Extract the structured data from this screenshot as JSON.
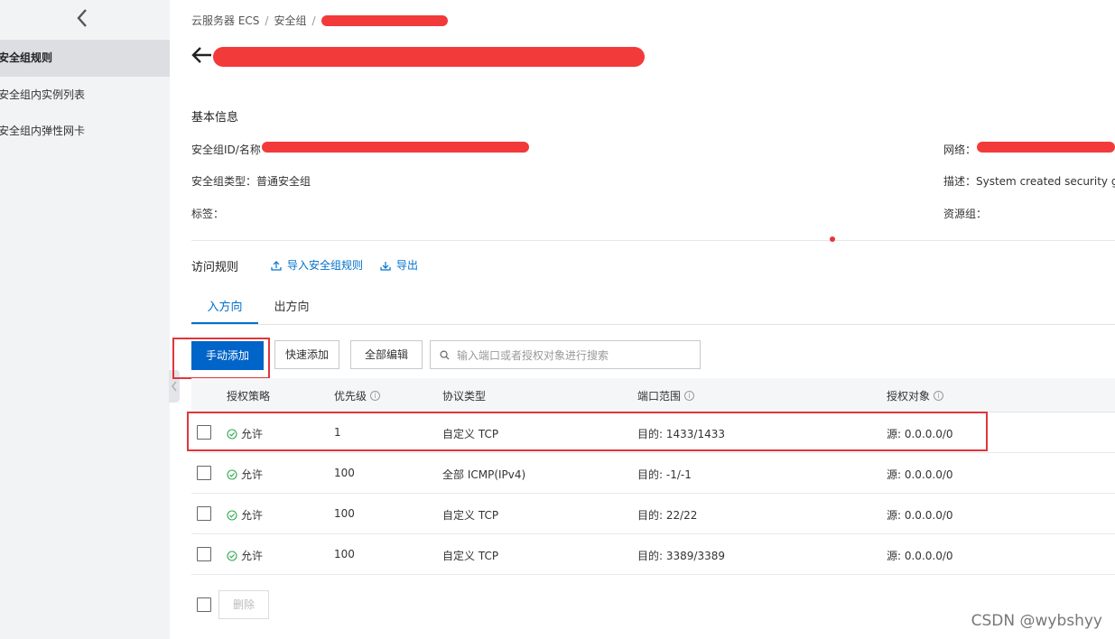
{
  "sidebar": {
    "items": [
      {
        "label": "安全组规则",
        "active": true
      },
      {
        "label": "安全组内实例列表",
        "active": false
      },
      {
        "label": "安全组内弹性网卡",
        "active": false
      }
    ]
  },
  "breadcrumb": {
    "items": [
      "云服务器 ECS",
      "安全组"
    ],
    "separator": "/"
  },
  "basic_info": {
    "title": "基本信息",
    "sg_id_label": "安全组ID/名称",
    "network_label": "网络：",
    "sg_type": "安全组类型：普通安全组",
    "description": "描述：System created security grou",
    "tags_label": "标签：",
    "resource_group_label": "资源组："
  },
  "access_rules": {
    "title": "访问规则",
    "import_label": "导入安全组规则",
    "export_label": "导出"
  },
  "tabs": [
    {
      "label": "入方向",
      "active": true
    },
    {
      "label": "出方向",
      "active": false
    }
  ],
  "toolbar": {
    "manual_add": "手动添加",
    "quick_add": "快速添加",
    "edit_all": "全部编辑",
    "search_placeholder": "输入端口或者授权对象进行搜索"
  },
  "table": {
    "columns": [
      "授权策略",
      "优先级",
      "协议类型",
      "端口范围",
      "授权对象"
    ],
    "rows": [
      {
        "policy": "允许",
        "priority": "1",
        "protocol": "自定义 TCP",
        "port": "目的: 1433/1433",
        "source": "源: 0.0.0.0/0"
      },
      {
        "policy": "允许",
        "priority": "100",
        "protocol": "全部 ICMP(IPv4)",
        "port": "目的: -1/-1",
        "source": "源: 0.0.0.0/0"
      },
      {
        "policy": "允许",
        "priority": "100",
        "protocol": "自定义 TCP",
        "port": "目的: 22/22",
        "source": "源: 0.0.0.0/0"
      },
      {
        "policy": "允许",
        "priority": "100",
        "protocol": "自定义 TCP",
        "port": "目的: 3389/3389",
        "source": "源: 0.0.0.0/0"
      }
    ]
  },
  "footer": {
    "delete_label": "删除"
  },
  "watermark": "CSDN @wybshyy",
  "colors": {
    "primary": "#0064c8",
    "link": "#0070cc",
    "highlight": "#e0363b",
    "success": "#2fa84f"
  }
}
